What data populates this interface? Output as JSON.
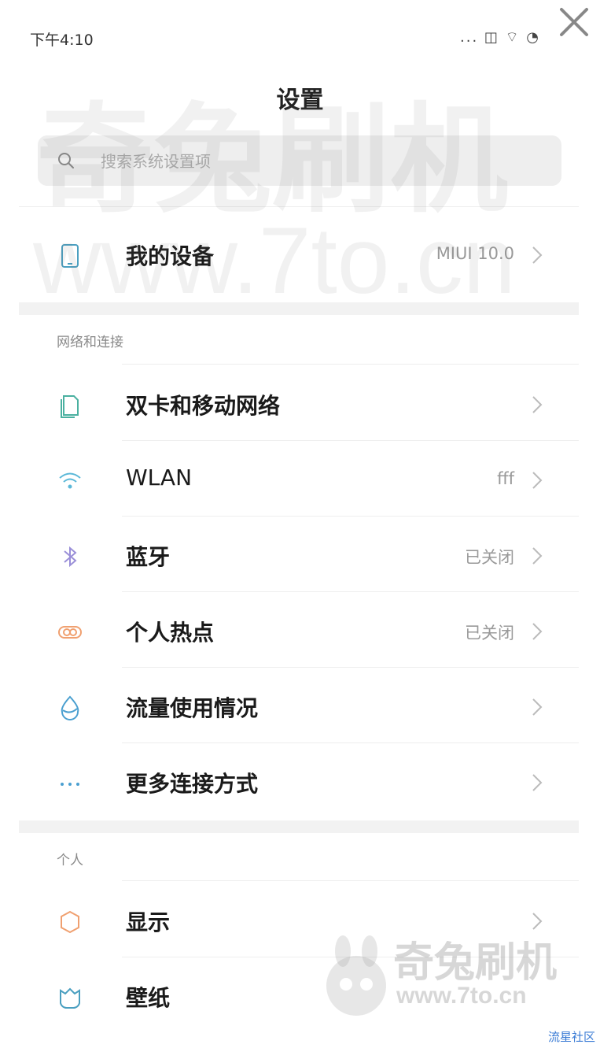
{
  "status_bar": {
    "time": "下午4:10",
    "icons": "... ◫ ⌔ ◔"
  },
  "header": {
    "title": "设置"
  },
  "search": {
    "placeholder": "搜索系统设置项"
  },
  "device": {
    "label": "我的设备",
    "value": "MIUI 10.0"
  },
  "sections": [
    {
      "title": "网络和连接",
      "items": [
        {
          "label": "双卡和移动网络",
          "value": "",
          "icon": "sim-card-icon"
        },
        {
          "label": "WLAN",
          "value": "fff",
          "icon": "wifi-icon"
        },
        {
          "label": "蓝牙",
          "value": "已关闭",
          "icon": "bluetooth-icon"
        },
        {
          "label": "个人热点",
          "value": "已关闭",
          "icon": "hotspot-icon"
        },
        {
          "label": "流量使用情况",
          "value": "",
          "icon": "data-usage-icon"
        },
        {
          "label": "更多连接方式",
          "value": "",
          "icon": "more-icon"
        }
      ]
    },
    {
      "title": "个人",
      "items": [
        {
          "label": "显示",
          "value": "",
          "icon": "display-icon"
        },
        {
          "label": "壁纸",
          "value": "",
          "icon": "wallpaper-icon"
        }
      ]
    }
  ],
  "watermark": {
    "line1": "奇兔刷机",
    "line2": "www.7to.cn",
    "badge1": "奇兔刷机",
    "badge2": "www.7to.cn"
  },
  "credit": "流星社区",
  "colors": {
    "accent_blue": "#3a7bd5",
    "wifi": "#5bb8d8",
    "bluetooth": "#9a8fd8",
    "hotspot": "#f0a070",
    "display": "#f0a070",
    "wallpaper": "#4a9fc0"
  }
}
